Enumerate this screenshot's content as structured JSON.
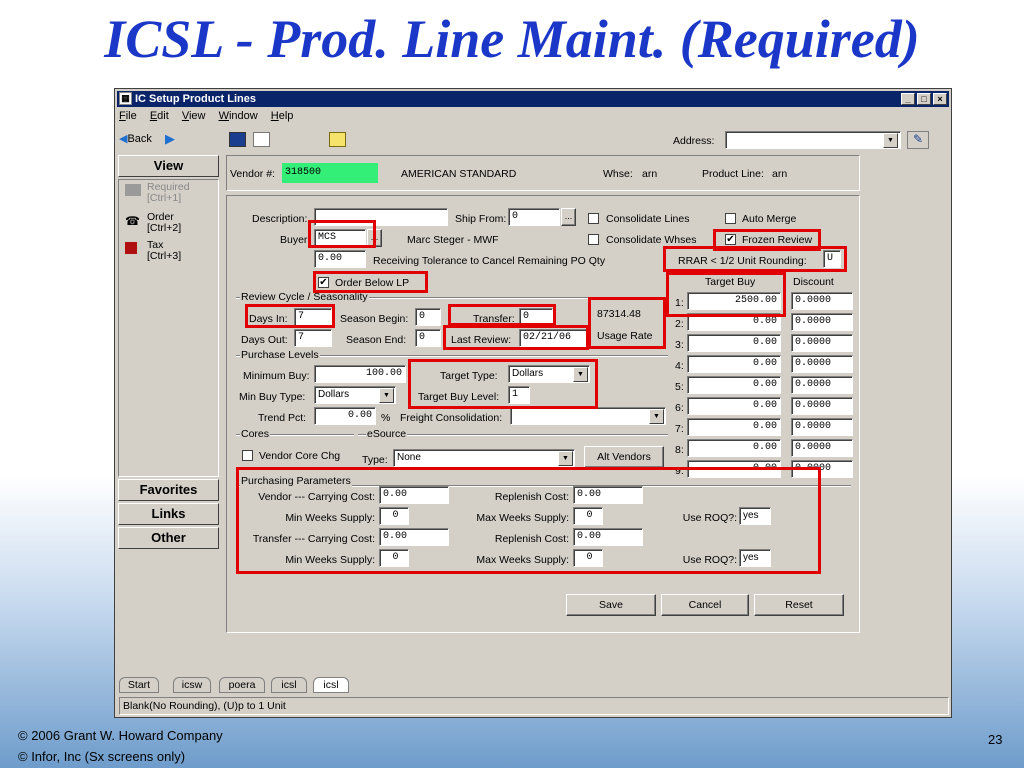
{
  "slide": {
    "title": "ICSL - Prod. Line Maint. (Required)",
    "copyright1": "© 2006 Grant W. Howard Company",
    "copyright2": "© Infor, Inc (Sx screens only)",
    "page_number": "23"
  },
  "window": {
    "title": "IC Setup Product Lines",
    "menus": [
      "File",
      "Edit",
      "View",
      "Window",
      "Help"
    ],
    "back_label": "Back",
    "address_label": "Address:"
  },
  "sidebar": {
    "view_label": "View",
    "items": [
      {
        "label": "Required",
        "shortcut": "[Ctrl+1]"
      },
      {
        "label": "Order",
        "shortcut": "[Ctrl+2]"
      },
      {
        "label": "Tax",
        "shortcut": "[Ctrl+3]"
      }
    ],
    "favorites_label": "Favorites",
    "links_label": "Links",
    "other_label": "Other"
  },
  "header": {
    "vendor_label": "Vendor #:",
    "vendor_no": "318500",
    "vendor_name": "AMERICAN STANDARD",
    "whse_label": "Whse:",
    "whse_value": "arn",
    "prodline_label": "Product Line:",
    "prodline_value": "arn"
  },
  "form": {
    "description_label": "Description:",
    "description_value": "",
    "shipfrom_label": "Ship From:",
    "shipfrom_value": "0",
    "consolidate_lines_label": "Consolidate Lines",
    "automerge_label": "Auto Merge",
    "buyer_label": "Buyer:",
    "buyer_value": "MCS",
    "buyer_name": "Marc Steger - MWF",
    "consolidate_whses_label": "Consolidate Whses",
    "frozen_review_label": "Frozen Review",
    "tolerance_value": "0.00",
    "tolerance_label": "Receiving Tolerance to Cancel Remaining PO Qty",
    "rrar_label": "RRAR < 1/2 Unit Rounding:",
    "rrar_value": "U",
    "order_below_lp_label": "Order Below LP",
    "target_buy_header": "Target Buy",
    "discount_header": "Discount",
    "review_cycle_label": "Review Cycle / Seasonality",
    "days_in_label": "Days In:",
    "days_in_value": "7",
    "season_begin_label": "Season Begin:",
    "season_begin_value": "0",
    "transfer_label": "Transfer:",
    "transfer_value": "0",
    "usage_value": "87314.48",
    "usage_label": "Usage Rate",
    "days_out_label": "Days Out:",
    "days_out_value": "7",
    "season_end_label": "Season End:",
    "season_end_value": "0",
    "last_review_label": "Last Review:",
    "last_review_value": "02/21/06",
    "purchase_levels_label": "Purchase Levels",
    "min_buy_label": "Minimum Buy:",
    "min_buy_value": "100.00",
    "target_type_label": "Target Type:",
    "target_type_value": "Dollars",
    "min_buy_type_label": "Min Buy Type:",
    "min_buy_type_value": "Dollars",
    "target_buy_level_label": "Target Buy Level:",
    "target_buy_level_value": "1",
    "trend_pct_label": "Trend Pct:",
    "trend_pct_value": "0.00",
    "pct_sign": "%",
    "freight_label": "Freight Consolidation:",
    "freight_value": "",
    "cores_label": "Cores",
    "vendor_core_label": "Vendor Core Chg",
    "esource_label": "eSource",
    "type_label": "Type:",
    "type_value": "None",
    "alt_vendors_label": "Alt Vendors",
    "target_rows": [
      {
        "n": "1:",
        "buy": "2500.00",
        "disc": "0.0000"
      },
      {
        "n": "2:",
        "buy": "0.00",
        "disc": "0.0000"
      },
      {
        "n": "3:",
        "buy": "0.00",
        "disc": "0.0000"
      },
      {
        "n": "4:",
        "buy": "0.00",
        "disc": "0.0000"
      },
      {
        "n": "5:",
        "buy": "0.00",
        "disc": "0.0000"
      },
      {
        "n": "6:",
        "buy": "0.00",
        "disc": "0.0000"
      },
      {
        "n": "7:",
        "buy": "0.00",
        "disc": "0.0000"
      },
      {
        "n": "8:",
        "buy": "0.00",
        "disc": "0.0000"
      },
      {
        "n": "9:",
        "buy": "0.00",
        "disc": "0.0000"
      }
    ],
    "purchasing_params_label": "Purchasing Parameters",
    "vendor_carrying_label": "Vendor --- Carrying Cost:",
    "vendor_carrying_value": "0.00",
    "vendor_replenish_label": "Replenish Cost:",
    "vendor_replenish_value": "0.00",
    "min_weeks_label": "Min Weeks Supply:",
    "vendor_min_weeks_value": "0",
    "max_weeks_label": "Max Weeks Supply:",
    "vendor_max_weeks_value": "0",
    "use_roq_label": "Use ROQ?:",
    "vendor_use_roq_value": "yes",
    "transfer_carrying_label": "Transfer --- Carrying Cost:",
    "transfer_carrying_value": "0.00",
    "transfer_replenish_value": "0.00",
    "transfer_min_weeks_value": "0",
    "transfer_max_weeks_value": "0",
    "transfer_use_roq_value": "yes",
    "save_label": "Save",
    "cancel_label": "Cancel",
    "reset_label": "Reset"
  },
  "tabs": [
    "Start",
    "icsw",
    "poera",
    "icsl",
    "icsl"
  ],
  "status_text": "Blank(No Rounding), (U)p to 1 Unit",
  "colors": {
    "title": "#1a37c8",
    "highlight": "#e00000",
    "vendor_field": "#33ee77"
  }
}
